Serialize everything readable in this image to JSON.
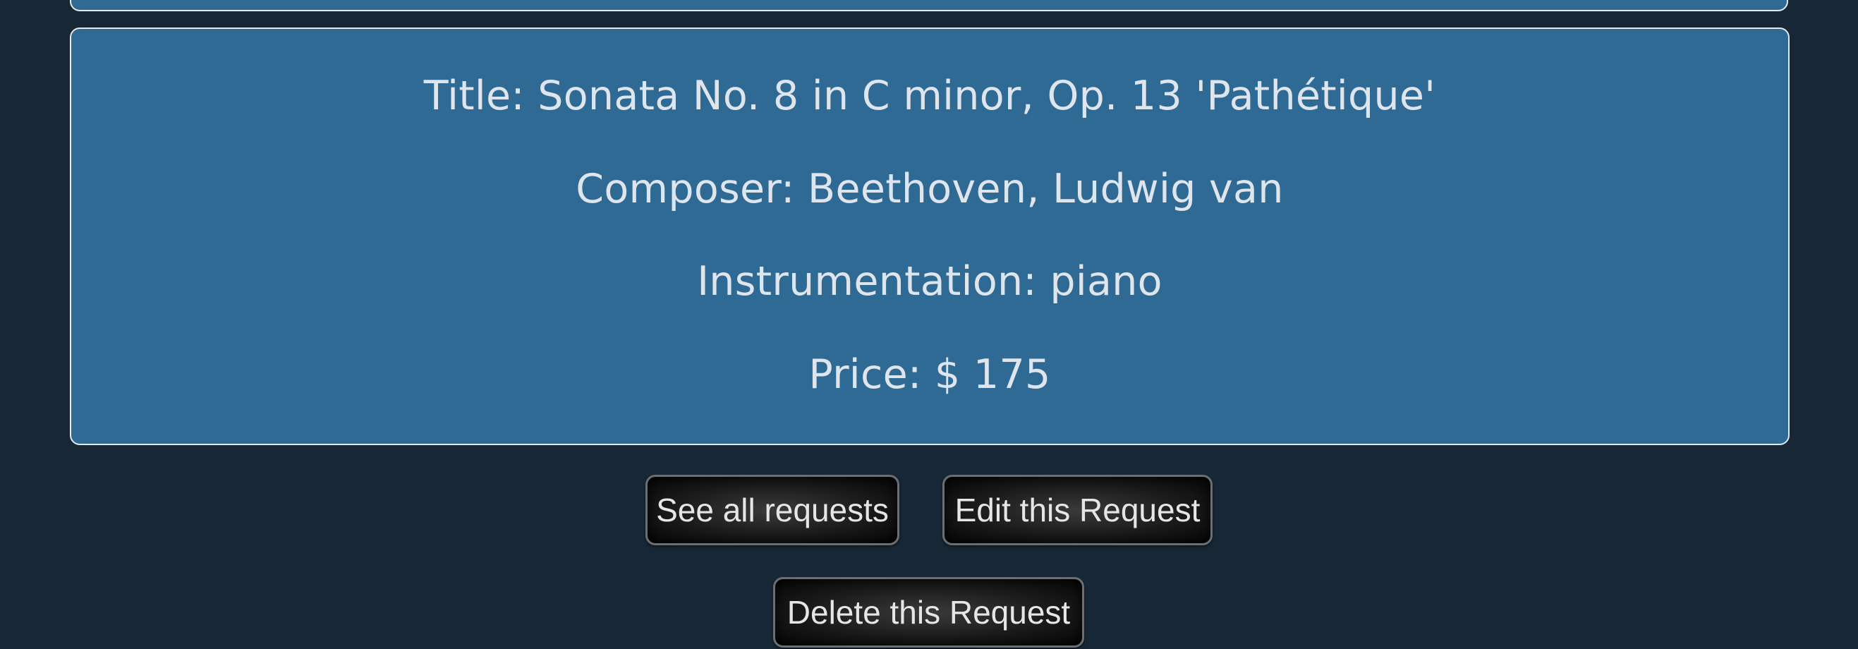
{
  "request": {
    "title_label": "Title:",
    "title": "Sonata No. 8 in C minor, Op. 13 'Pathétique'",
    "composer_label": "Composer:",
    "composer": "Beethoven, Ludwig van",
    "instrumentation_label": "Instrumentation:",
    "instrumentation": "piano",
    "price_label": "Price:",
    "price": "$ 175"
  },
  "actions": {
    "see_all_label": "See all requests",
    "edit_label": "Edit this Request",
    "delete_label": "Delete this Request"
  },
  "colors": {
    "page_background": "#182735",
    "card_background": "#2e6a94",
    "card_border": "#e4e9ee",
    "button_background": "#111111"
  }
}
